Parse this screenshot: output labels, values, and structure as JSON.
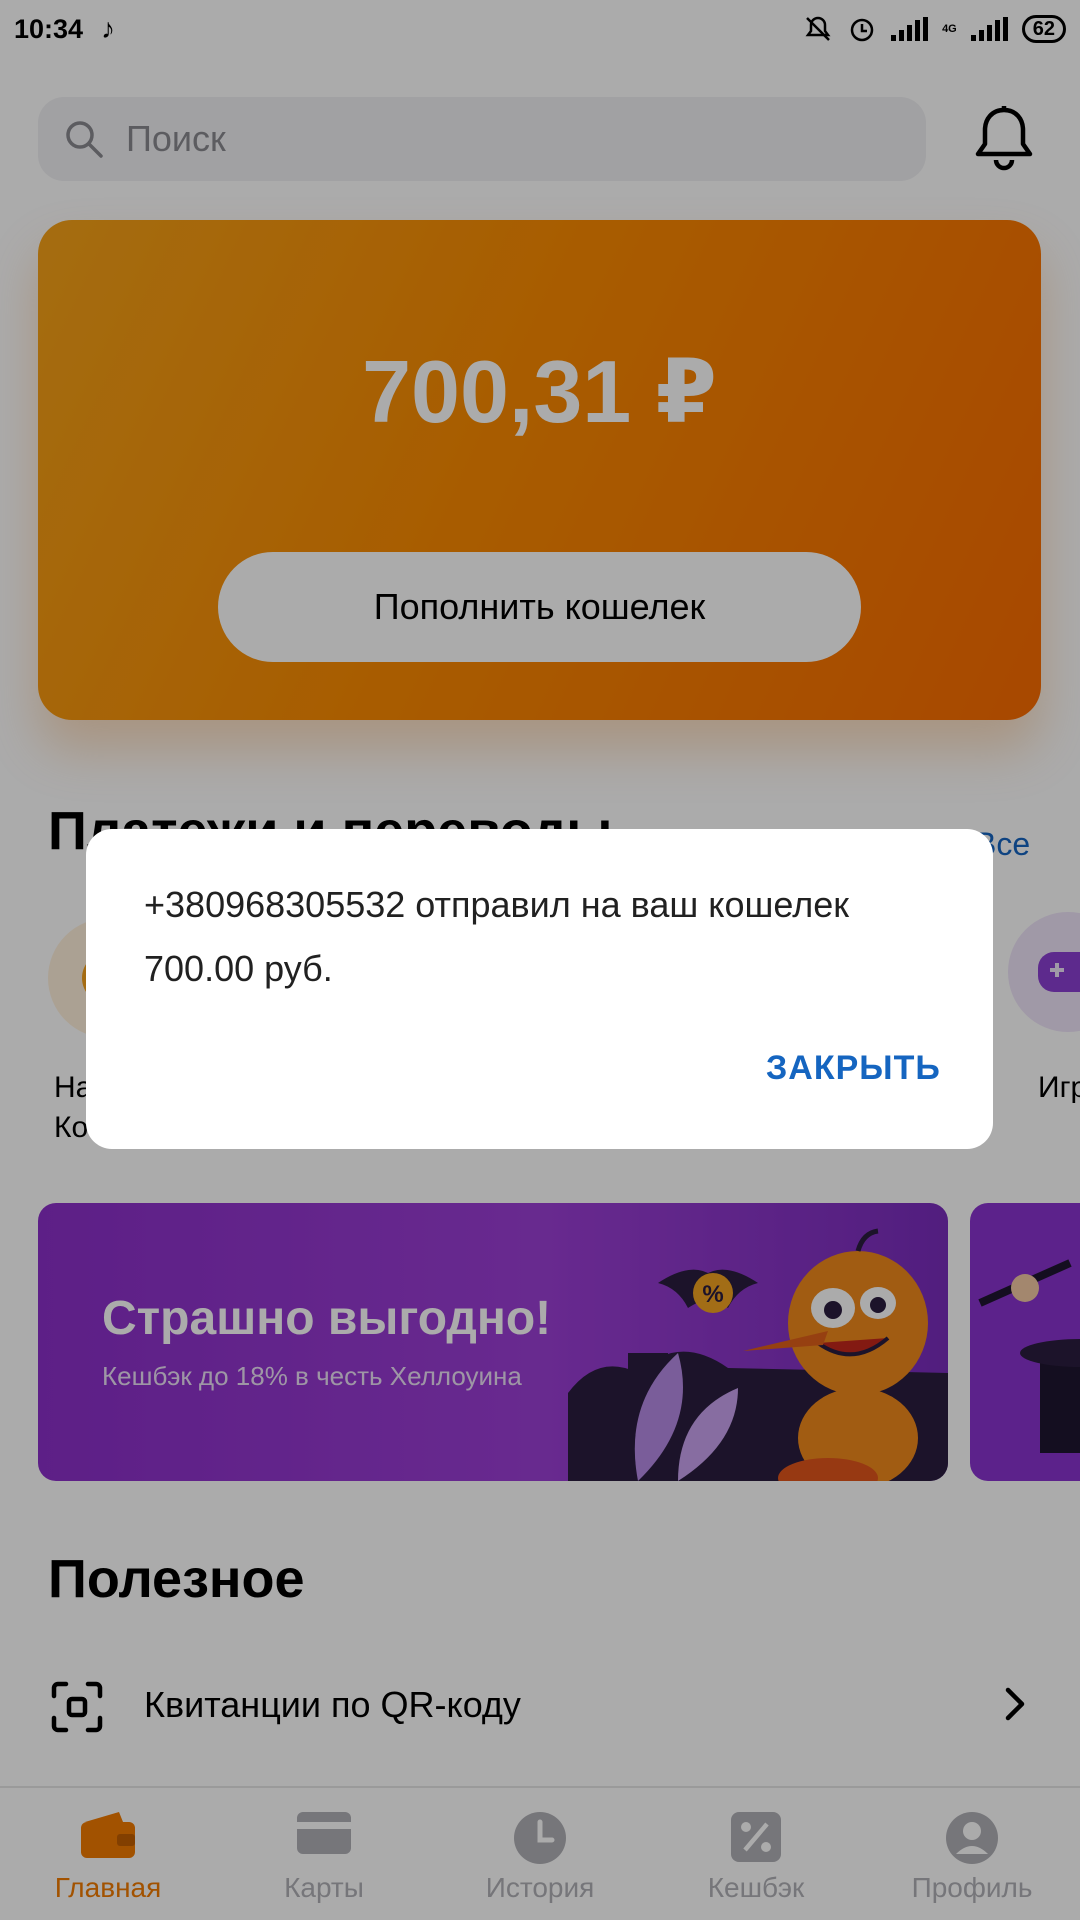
{
  "status_bar": {
    "time": "10:34",
    "battery": "62",
    "network": "4G"
  },
  "search": {
    "placeholder": "Поиск"
  },
  "wallet": {
    "balance": "700,31 ₽",
    "topup_label": "Пополнить кошелек",
    "color_from": "#f6a319",
    "color_to": "#fb6c00"
  },
  "payments": {
    "title": "Платежи и переводы",
    "all_label": "Все",
    "items": [
      {
        "label": "На\nКо",
        "icon": "coin-icon"
      },
      {
        "label": "Игр",
        "icon": "gamepad-icon"
      }
    ]
  },
  "promo": {
    "title": "Страшно выгодно!",
    "subtitle": "Кешбэк до 18% в честь Хеллоуина",
    "badge": "%"
  },
  "useful": {
    "title": "Полезное",
    "items": [
      {
        "label": "Квитанции по QR-коду",
        "icon": "qr-scan-icon"
      }
    ]
  },
  "tabbar": {
    "tabs": [
      {
        "label": "Главная",
        "icon": "wallet-icon",
        "active": true
      },
      {
        "label": "Карты",
        "icon": "card-icon",
        "active": false
      },
      {
        "label": "История",
        "icon": "clock-icon",
        "active": false
      },
      {
        "label": "Кешбэк",
        "icon": "percent-icon",
        "active": false
      },
      {
        "label": "Профиль",
        "icon": "profile-icon",
        "active": false
      }
    ],
    "accent": "#f27b00"
  },
  "dialog": {
    "message": "+380968305532 отправил на ваш кошелек 700.00 руб.",
    "close_label": "ЗАКРЫТЬ",
    "accent": "#1565c0"
  }
}
